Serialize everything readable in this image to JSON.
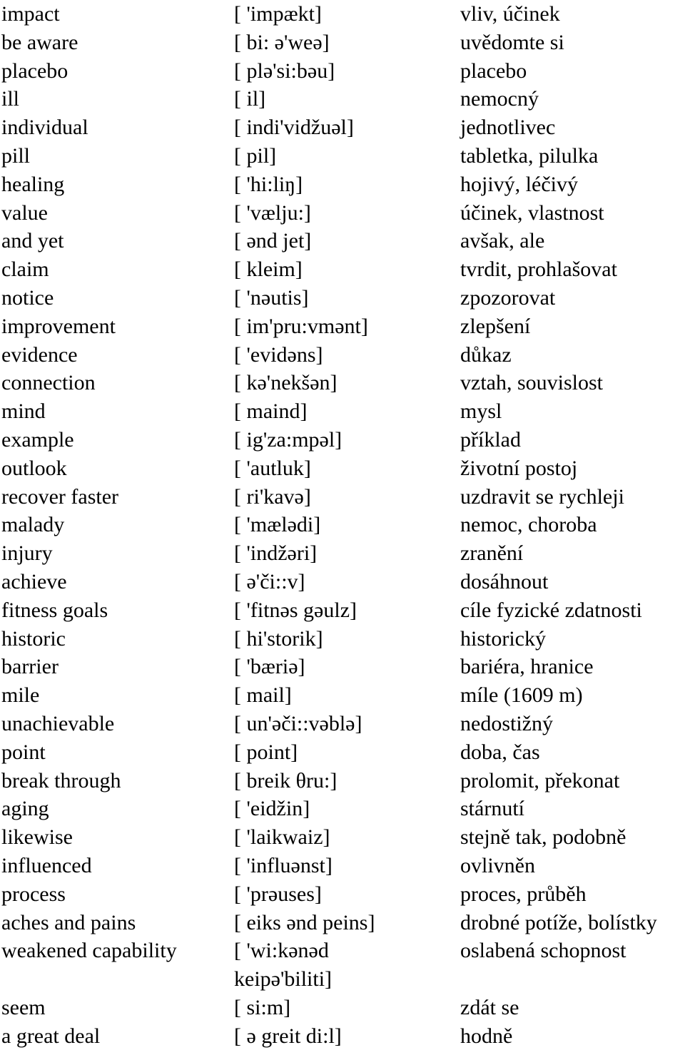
{
  "document": {
    "type": "vocabulary-list",
    "columns": [
      "term",
      "pronunciation",
      "translation"
    ],
    "language_pair": "English – Czech",
    "rows": [
      {
        "term": "impact",
        "pron": "[ 'impækt]",
        "cz": "vliv, účinek"
      },
      {
        "term": "be aware",
        "pron": "[ bi: ə'weə]",
        "cz": "uvědomte si"
      },
      {
        "term": "placebo",
        "pron": "[ plə'si:bəu]",
        "cz": "placebo"
      },
      {
        "term": "ill",
        "pron": "[ il]",
        "cz": "nemocný"
      },
      {
        "term": "individual",
        "pron": "[ indi'vidžuəl]",
        "cz": "jednotlivec"
      },
      {
        "term": "pill",
        "pron": "[ pil]",
        "cz": "tabletka, pilulka"
      },
      {
        "term": "healing",
        "pron": "[ 'hi:liŋ]",
        "cz": "hojivý, léčivý"
      },
      {
        "term": "value",
        "pron": "[ 'vælju:]",
        "cz": "účinek, vlastnost"
      },
      {
        "term": "and yet",
        "pron": "[ ənd jet]",
        "cz": "avšak, ale"
      },
      {
        "term": "claim",
        "pron": "[ kleim]",
        "cz": "tvrdit, prohlašovat"
      },
      {
        "term": "notice",
        "pron": "[ 'nəutis]",
        "cz": "zpozorovat"
      },
      {
        "term": "improvement",
        "pron": "[ im'pru:vmənt]",
        "cz": "zlepšení"
      },
      {
        "term": "evidence",
        "pron": "[ 'evidəns]",
        "cz": "důkaz"
      },
      {
        "term": "connection",
        "pron": "[ kə'nekšən]",
        "cz": "vztah, souvislost"
      },
      {
        "term": "mind",
        "pron": "[ maind]",
        "cz": "mysl"
      },
      {
        "term": "example",
        "pron": "[ ig'za:mpəl]",
        "cz": "příklad"
      },
      {
        "term": "outlook",
        "pron": "[ 'autluk]",
        "cz": "životní postoj"
      },
      {
        "term": "recover faster",
        "pron": "[ ri'kavə]",
        "cz": "uzdravit se rychleji"
      },
      {
        "term": "malady",
        "pron": "[ 'mælədi]",
        "cz": "nemoc, choroba"
      },
      {
        "term": "injury",
        "pron": "[ 'indžəri]",
        "cz": "zranění"
      },
      {
        "term": "achieve",
        "pron": "[ ə'či::v]",
        "cz": "dosáhnout"
      },
      {
        "term": "fitness goals",
        "pron": "[ 'fitnəs gəulz]",
        "cz": "cíle fyzické zdatnosti"
      },
      {
        "term": "historic",
        "pron": "[ hi'storik]",
        "cz": "historický"
      },
      {
        "term": "barrier",
        "pron": "[ 'bæriə]",
        "cz": "bariéra, hranice"
      },
      {
        "term": "mile",
        "pron": "[ mail]",
        "cz": "míle (1609 m)"
      },
      {
        "term": "unachievable",
        "pron": "[ un'əči::vəblə]",
        "cz": "nedostižný"
      },
      {
        "term": "point",
        "pron": "[ point]",
        "cz": "doba, čas"
      },
      {
        "term": "break through",
        "pron": "[ breik θru:]",
        "cz": "prolomit, překonat"
      },
      {
        "term": "aging",
        "pron": "[ 'eidžin]",
        "cz": "stárnutí"
      },
      {
        "term": "likewise",
        "pron": "[ 'laikwaiz]",
        "cz": "stejně tak, podobně"
      },
      {
        "term": "influenced",
        "pron": "[ 'influənst]",
        "cz": "ovlivněn"
      },
      {
        "term": "process",
        "pron": "[ 'prəuses]",
        "cz": "proces, průběh"
      },
      {
        "term": "aches and pains",
        "pron": "[ eiks ənd peins]",
        "cz": "drobné potíže, bolístky"
      },
      {
        "term": "weakened capability",
        "pron": "[ 'wi:kənəd",
        "cz": "oslabená schopnost"
      },
      {
        "term": "",
        "pron": "keipə'biliti]",
        "cz": ""
      },
      {
        "term": "seem",
        "pron": "[ si:m]",
        "cz": "zdát se"
      },
      {
        "term": "a great deal",
        "pron": "[ ə greit di:l]",
        "cz": "hodně"
      }
    ]
  }
}
